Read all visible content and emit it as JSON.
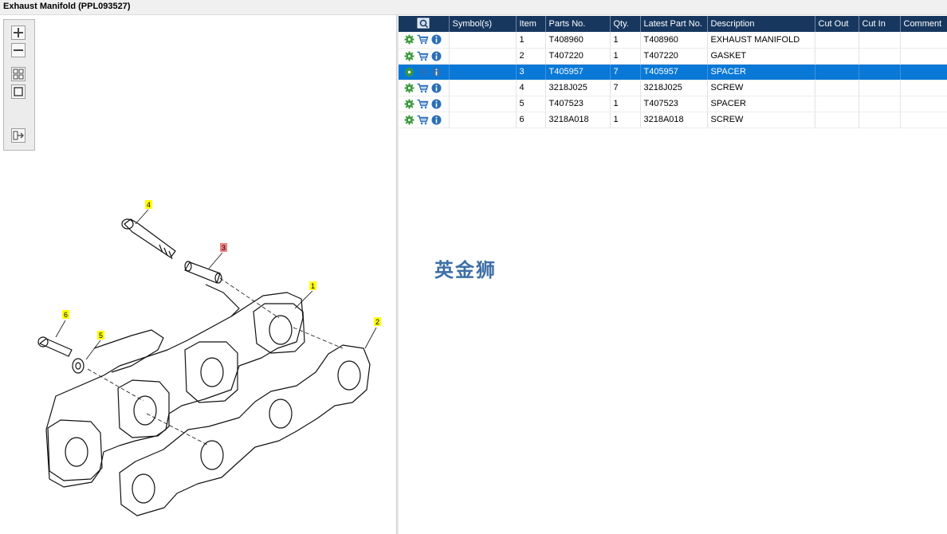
{
  "window": {
    "title": "Exhaust Manifold (PPL093527)"
  },
  "toolbar": {
    "buttons": [
      {
        "name": "zoom-in-button",
        "icon": "zoom-in-icon"
      },
      {
        "name": "zoom-out-button",
        "icon": "zoom-out-icon"
      },
      {
        "name": "fit-all-button",
        "icon": "grid-icon"
      },
      {
        "name": "fit-window-button",
        "icon": "frame-icon"
      },
      {
        "name": "export-button",
        "icon": "export-icon"
      }
    ]
  },
  "callouts": [
    {
      "label": "1",
      "color": "#ffff00"
    },
    {
      "label": "2",
      "color": "#ffff00"
    },
    {
      "label": "3",
      "color": "#f08080"
    },
    {
      "label": "4",
      "color": "#ffff00"
    },
    {
      "label": "5",
      "color": "#ffff00"
    },
    {
      "label": "6",
      "color": "#ffff00"
    }
  ],
  "table": {
    "columns": [
      "Symbol(s)",
      "Item",
      "Parts No.",
      "Qty.",
      "Latest Part No.",
      "Description",
      "Cut Out",
      "Cut In",
      "Comment"
    ],
    "header_icon": "search-list-icon",
    "selected_index": 2,
    "rows": [
      {
        "symbols": "",
        "item": "1",
        "part_no": "T408960",
        "qty": "1",
        "latest": "T408960",
        "desc": "EXHAUST MANIFOLD",
        "cut_out": "",
        "cut_in": "",
        "comment": ""
      },
      {
        "symbols": "",
        "item": "2",
        "part_no": "T407220",
        "qty": "1",
        "latest": "T407220",
        "desc": "GASKET",
        "cut_out": "",
        "cut_in": "",
        "comment": ""
      },
      {
        "symbols": "",
        "item": "3",
        "part_no": "T405957",
        "qty": "7",
        "latest": "T405957",
        "desc": "SPACER",
        "cut_out": "",
        "cut_in": "",
        "comment": ""
      },
      {
        "symbols": "",
        "item": "4",
        "part_no": "3218J025",
        "qty": "7",
        "latest": "3218J025",
        "desc": "SCREW",
        "cut_out": "",
        "cut_in": "",
        "comment": ""
      },
      {
        "symbols": "",
        "item": "5",
        "part_no": "T407523",
        "qty": "1",
        "latest": "T407523",
        "desc": "SPACER",
        "cut_out": "",
        "cut_in": "",
        "comment": ""
      },
      {
        "symbols": "",
        "item": "6",
        "part_no": "3218A018",
        "qty": "1",
        "latest": "3218A018",
        "desc": "SCREW",
        "cut_out": "",
        "cut_in": "",
        "comment": ""
      }
    ]
  },
  "watermark": "英金狮",
  "colors": {
    "header_bg": "#17375f",
    "selected_bg": "#0a78d7",
    "gear": "#3a9a3a",
    "cart": "#2a6fb8",
    "info": "#2a6fb8"
  }
}
